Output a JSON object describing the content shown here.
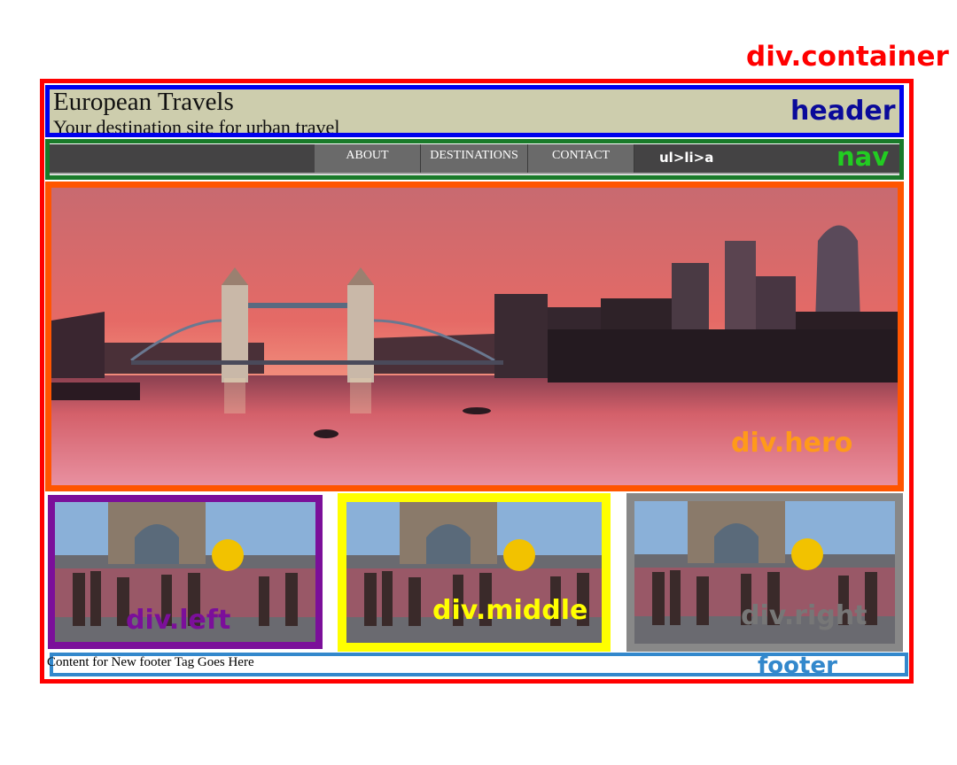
{
  "header": {
    "title": "European Travels",
    "subtitle": "Your destination site for urban travel"
  },
  "nav": {
    "links": [
      "ABOUT",
      "DESTINATIONS",
      "CONTACT"
    ],
    "selector_note": "ul>li>a"
  },
  "footer": {
    "text": "Content for New footer Tag Goes Here"
  },
  "annotations": {
    "container": "div.container",
    "header": "header",
    "nav": "nav",
    "hero": "div.hero",
    "left": "div.left",
    "middle": "div.middle",
    "right": "div.right",
    "footer": "footer"
  },
  "colors": {
    "container": "#ff0000",
    "header": "#0000ee",
    "header_bg": "#cdcdad",
    "nav": "#1a7a2a",
    "nav_label": "#22cc22",
    "hero": "#ff5500",
    "hero_label": "#ff9a1a",
    "left": "#7b0f9a",
    "middle": "#ffff00",
    "right": "#888888",
    "footer": "#3388cc"
  },
  "images": {
    "hero": "tower-bridge-london-skyline-sunset",
    "thumbnails": "london-marathon-runners-tower-bridge"
  }
}
